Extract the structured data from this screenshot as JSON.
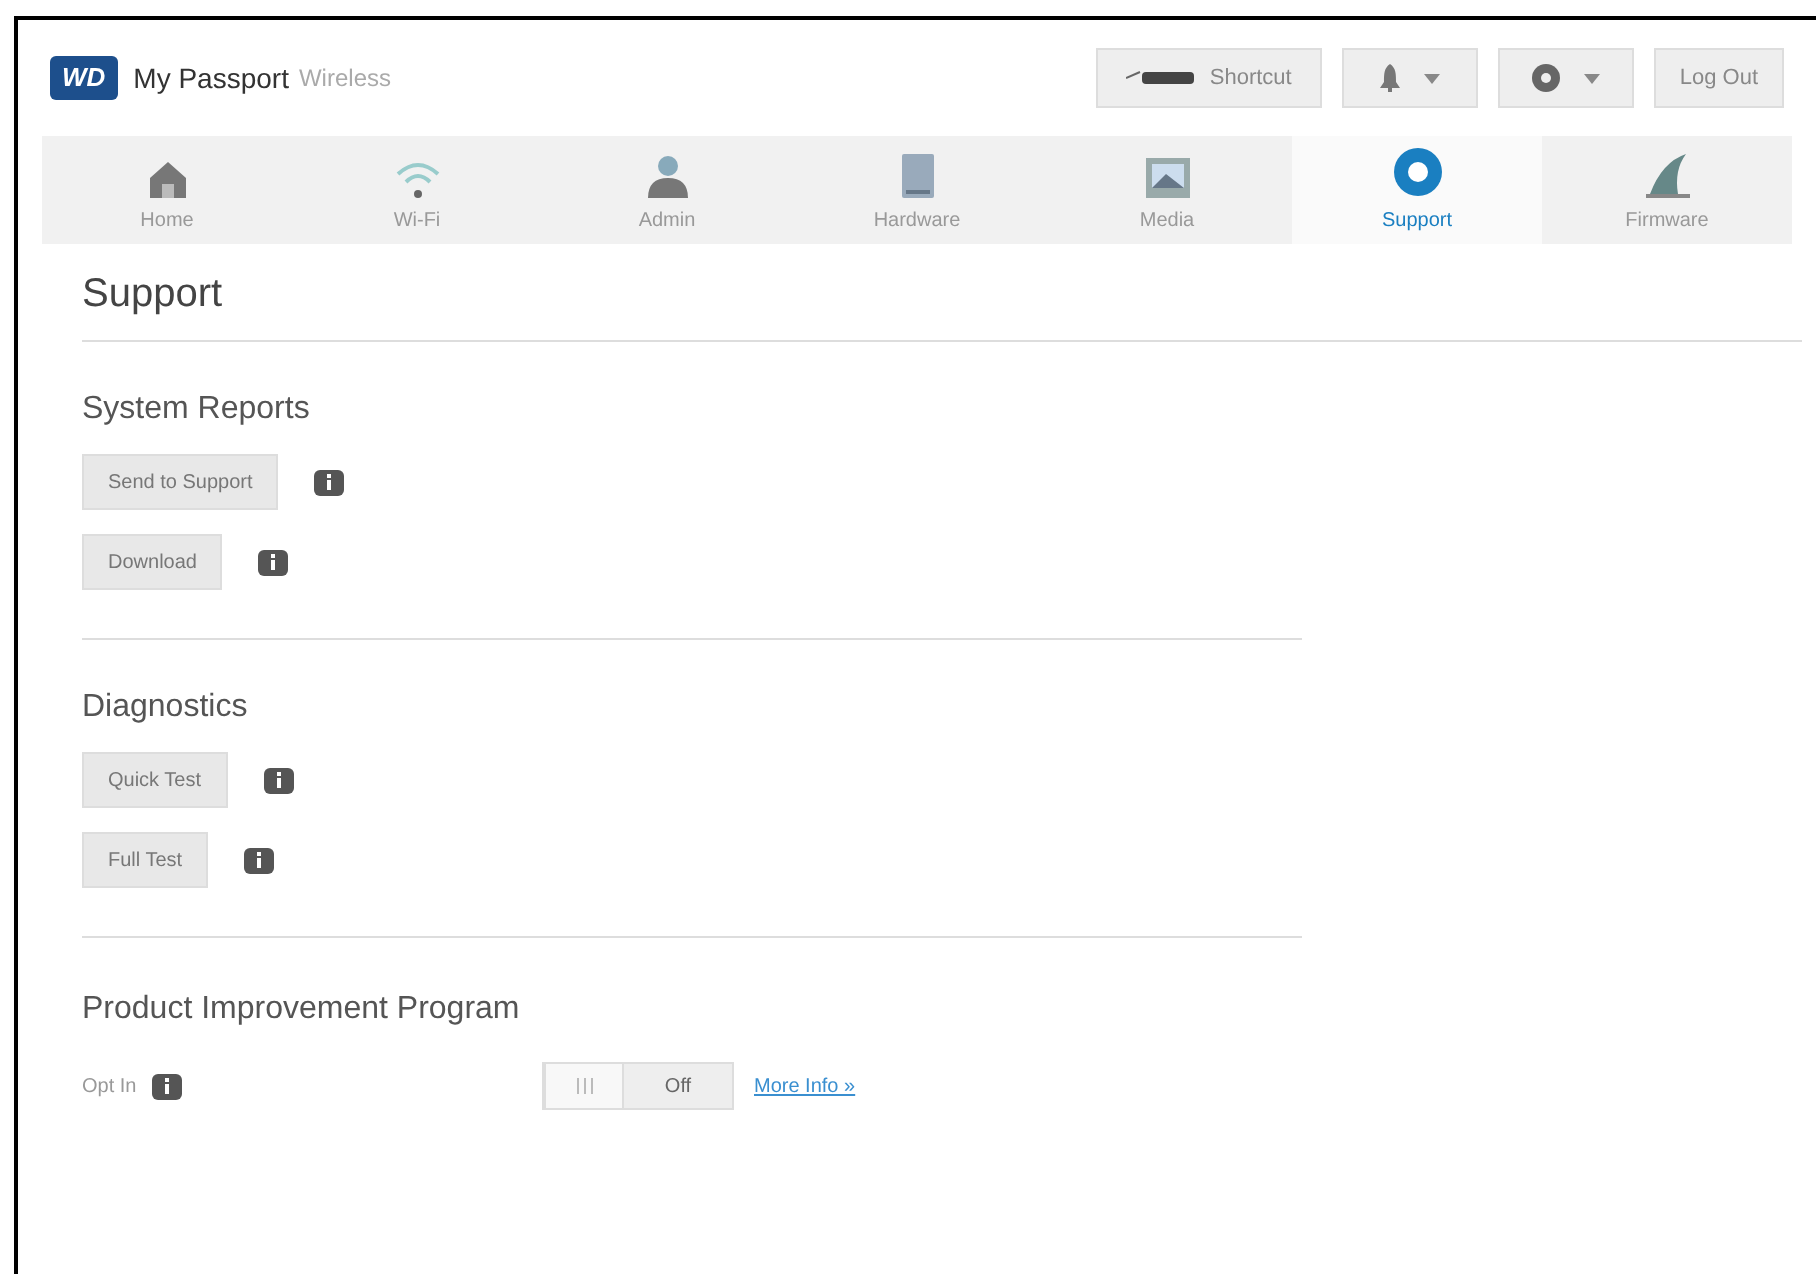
{
  "header": {
    "logo": "WD",
    "product": "My Passport",
    "product_suffix": "Wireless",
    "shortcut": "Shortcut",
    "logout": "Log Out"
  },
  "nav": [
    {
      "label": "Home",
      "kind": "home",
      "selected": false
    },
    {
      "label": "Wi-Fi",
      "kind": "wifi",
      "selected": false
    },
    {
      "label": "Admin",
      "kind": "user",
      "selected": false
    },
    {
      "label": "Hardware",
      "kind": "drive",
      "selected": false
    },
    {
      "label": "Media",
      "kind": "picture",
      "selected": false
    },
    {
      "label": "Support",
      "kind": "lifebuoy",
      "selected": true
    },
    {
      "label": "Firmware",
      "kind": "fin",
      "selected": false
    }
  ],
  "page_title": "Support",
  "sections": [
    {
      "title": "System Reports",
      "buttons": [
        "Send to Support",
        "Download"
      ]
    },
    {
      "title": "Diagnostics",
      "buttons": [
        "Quick Test",
        "Full Test"
      ]
    }
  ],
  "program": {
    "title": "Product Improvement Program",
    "label": "Opt In",
    "toggle": {
      "on": false,
      "text": "Off"
    },
    "link": "More Info »"
  }
}
